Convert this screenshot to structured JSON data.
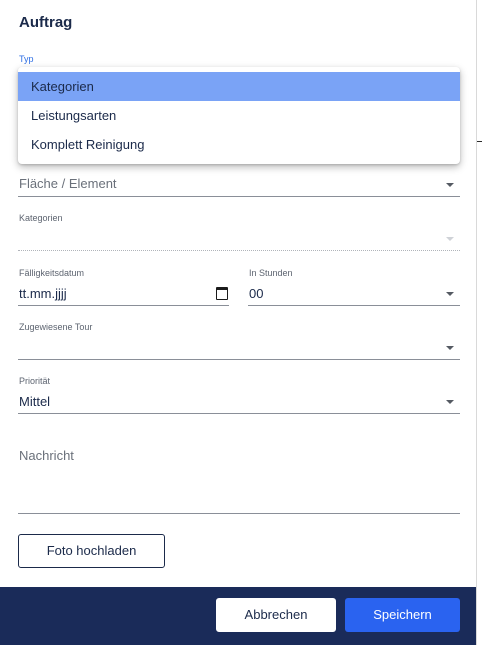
{
  "dialog": {
    "title": "Auftrag"
  },
  "type_field": {
    "label": "Typ",
    "options": [
      "Kategorien",
      "Leistungsarten",
      "Komplett Reinigung"
    ],
    "selected": "Kategorien"
  },
  "area_field": {
    "placeholder": "Fläche / Element"
  },
  "category_field": {
    "label": "Kategorien"
  },
  "due_date_field": {
    "label": "Fälligkeitsdatum",
    "value": "tt.mm.jjjj",
    "icon": "calendar-icon"
  },
  "hours_field": {
    "label": "In Stunden",
    "value": "00"
  },
  "tour_field": {
    "label": "Zugewiesene Tour"
  },
  "priority_field": {
    "label": "Priorität",
    "value": "Mittel"
  },
  "message_field": {
    "placeholder": "Nachricht"
  },
  "upload_button": {
    "label": "Foto hochladen"
  },
  "footer": {
    "cancel_label": "Abbrechen",
    "save_label": "Speichern",
    "background_color": "#1a2b59",
    "save_color": "#2a63f0"
  },
  "colors": {
    "menu_selected": "#7aa3f6",
    "label_active": "#2f6fe4"
  }
}
